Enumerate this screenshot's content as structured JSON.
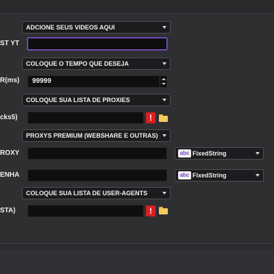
{
  "rows": {
    "videos": {
      "dropdown": "ADCIONE SEUS VIDEOS AQUI",
      "label": "ST YT",
      "value": ""
    },
    "tempo": {
      "dropdown": "COLOQUE O TEMPO QUE DESEJA",
      "label": "R(ms)",
      "value": "99999"
    },
    "proxies": {
      "dropdown": "COLOQUE SUA LISTA DE PROXIES",
      "label": "cks5)",
      "value": "",
      "warn": "!"
    },
    "premium": {
      "dropdown": "PROXYS PREMIUM (WEBSHARE E OUTRAS)",
      "proxy_label": "ROXY",
      "proxy_value": "",
      "proxy_type": "FixedString",
      "senha_label": "ENHA",
      "senha_value": "",
      "senha_type": "FixedString",
      "type_badge": "abc"
    },
    "useragents": {
      "dropdown": "COLOQUE SUA LISTA DE USER-AGENTS",
      "label": "STA)",
      "value": "",
      "warn": "!"
    }
  },
  "colors": {
    "background": "#2f2f32",
    "focus_accent": "#8b5bd6",
    "warning": "#d9201f",
    "folder": "#f3cc5a",
    "type_badge_text": "#7a3fd0"
  },
  "icons": {
    "dropdown_caret": "chevron-down-icon",
    "warning": "warning-icon",
    "folder": "folder-icon",
    "spinner": "spinner-arrows-icon"
  }
}
